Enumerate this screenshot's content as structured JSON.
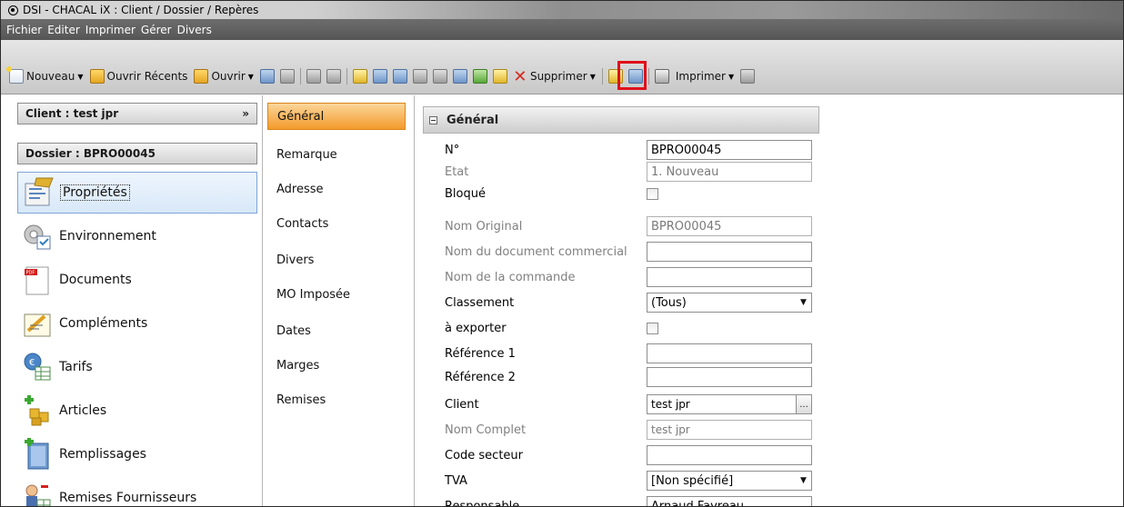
{
  "window": {
    "title": "DSI - CHACAL iX : Client / Dossier / Repères"
  },
  "menu": {
    "items": [
      "Fichier",
      "Editer",
      "Imprimer",
      "Gérer",
      "Divers"
    ]
  },
  "toolbar": {
    "nouveau": "Nouveau",
    "ouvrir_recents": "Ouvrir Récents",
    "ouvrir": "Ouvrir",
    "supprimer": "Supprimer",
    "imprimer": "Imprimer",
    "highlight_color": "#e0101a"
  },
  "left": {
    "client_header": "Client : test jpr",
    "dossier_header": "Dossier : BPRO00045",
    "items": [
      {
        "label": "Propriétés",
        "icon": "properties-icon"
      },
      {
        "label": "Environnement",
        "icon": "environment-icon"
      },
      {
        "label": "Documents",
        "icon": "pdf-document-icon"
      },
      {
        "label": "Compléments",
        "icon": "complements-icon"
      },
      {
        "label": "Tarifs",
        "icon": "tarifs-icon"
      },
      {
        "label": "Articles",
        "icon": "articles-icon"
      },
      {
        "label": "Remplissages",
        "icon": "remplissages-icon"
      },
      {
        "label": "Remises Fournisseurs",
        "icon": "remises-fournisseurs-icon"
      }
    ]
  },
  "tabs": [
    "Général",
    "Remarque",
    "Adresse",
    "Contacts",
    "Divers",
    "MO Imposée",
    "Dates",
    "Marges",
    "Remises"
  ],
  "section": {
    "title": "Général"
  },
  "props": [
    {
      "label": "N°",
      "value": "BPRO00045"
    },
    {
      "label": "Etat",
      "value": "1. Nouveau"
    },
    {
      "label": "Bloqué",
      "value": ""
    },
    {
      "label": "Nom Original",
      "value": "BPRO00045"
    },
    {
      "label": "Nom du document commercial",
      "value": ""
    },
    {
      "label": "Nom de la commande",
      "value": ""
    },
    {
      "label": "Classement",
      "value": "(Tous)"
    },
    {
      "label": "à exporter",
      "value": ""
    },
    {
      "label": "Référence 1",
      "value": ""
    },
    {
      "label": "Référence 2",
      "value": ""
    },
    {
      "label": "Client",
      "value": "test jpr"
    },
    {
      "label": "Nom Complet",
      "value": "test jpr"
    },
    {
      "label": "Code secteur",
      "value": ""
    },
    {
      "label": "TVA",
      "value": "[Non spécifié]"
    },
    {
      "label": "Responsable",
      "value": "Arnaud Favreau"
    }
  ],
  "colors": {
    "active_tab": "#f39a2c",
    "selected_nav": "#d8e8f8"
  }
}
